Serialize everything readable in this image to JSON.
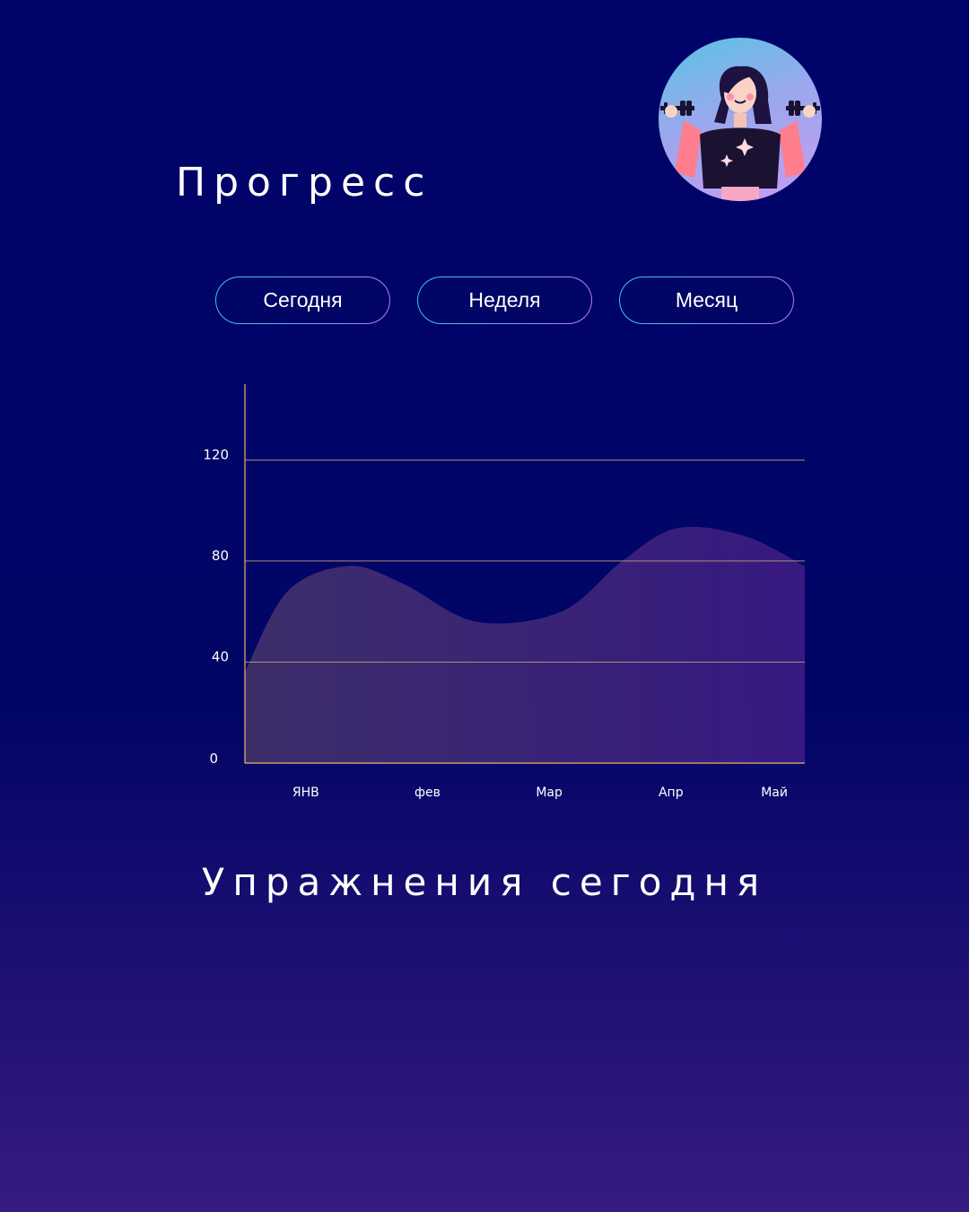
{
  "header": {
    "title": "Прогресс"
  },
  "tabs": [
    {
      "label": "Сегодня"
    },
    {
      "label": "Неделя"
    },
    {
      "label": "Месяц"
    }
  ],
  "avatar": {
    "icon": "woman-lifting-dumbbells-illustration"
  },
  "chart_data": {
    "type": "area",
    "categories": [
      "ЯНВ",
      "фев",
      "Мар",
      "Апр",
      "Май"
    ],
    "x": [
      0.5,
      1.5,
      2.5,
      3.5,
      4.35
    ],
    "x_extent": [
      0,
      4.6
    ],
    "curve": [
      {
        "x": 0.0,
        "y": 36
      },
      {
        "x": 0.35,
        "y": 68
      },
      {
        "x": 0.85,
        "y": 78
      },
      {
        "x": 1.3,
        "y": 71
      },
      {
        "x": 1.9,
        "y": 56
      },
      {
        "x": 2.6,
        "y": 60
      },
      {
        "x": 3.1,
        "y": 80
      },
      {
        "x": 3.55,
        "y": 93
      },
      {
        "x": 4.1,
        "y": 90
      },
      {
        "x": 4.6,
        "y": 78
      }
    ],
    "yticks": [
      0,
      40,
      80,
      120
    ],
    "ylim": [
      0,
      150
    ],
    "grid": true,
    "colors": {
      "axis": "#e8b56a",
      "grid": "#b08a7a",
      "fill_start": "#40306a",
      "fill_end": "#3a1a82"
    }
  },
  "section": {
    "title": "Упражнения сегодня"
  }
}
